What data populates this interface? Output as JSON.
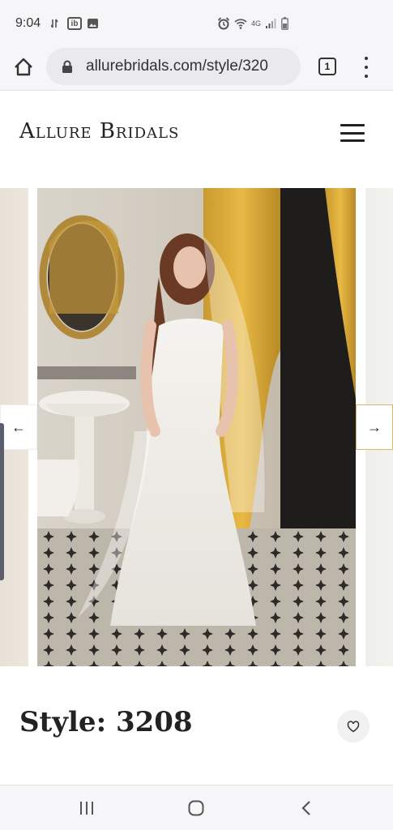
{
  "status_bar": {
    "time": "9:04",
    "left_icons": [
      "network-speed-icon",
      "ib-app-icon",
      "gallery-icon"
    ],
    "ib_label": "ib",
    "right_icons": [
      "alarm-icon",
      "wifi-icon",
      "signal-icon",
      "battery-icon"
    ],
    "network_label": "4G"
  },
  "browser": {
    "url": "allurebridals.com/style/320",
    "tab_count": "1"
  },
  "site": {
    "brand": "Allure Bridals",
    "menu_icon": "hamburger-icon"
  },
  "carousel": {
    "prev_label": "←",
    "next_label": "→",
    "image_alt": "Bride in a lace strapless gown and veil standing in an ornate bathroom"
  },
  "product": {
    "title": "Style: 3208",
    "favorite_icon": "heart-icon"
  },
  "nav": {
    "recents_icon": "recents-icon",
    "home_icon": "home-circle-icon",
    "back_icon": "back-icon"
  },
  "colors": {
    "accent_gold": "#d8b76b",
    "chrome_bg": "#f6f6f8"
  }
}
